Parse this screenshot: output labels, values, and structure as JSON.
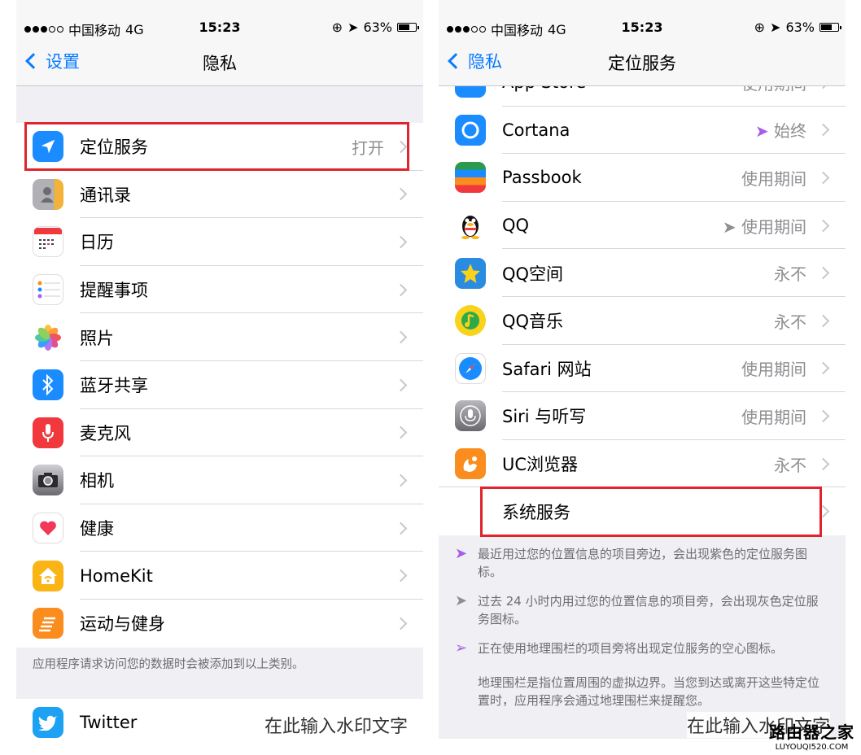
{
  "left": {
    "status": {
      "carrier": "中国移动",
      "network": "4G",
      "time": "15:23",
      "battery": "63%"
    },
    "nav": {
      "back_label": "设置",
      "title": "隐私"
    },
    "group1": [
      {
        "label": "定位服务",
        "value": "打开",
        "icon": "location-arrow-icon",
        "color": "#1a8cff"
      },
      {
        "label": "通讯录",
        "value": "",
        "icon": "contacts-icon",
        "color": "#8e8e93"
      },
      {
        "label": "日历",
        "value": "",
        "icon": "calendar-icon",
        "color": "#ffffff"
      },
      {
        "label": "提醒事项",
        "value": "",
        "icon": "reminders-icon",
        "color": "#ffffff"
      },
      {
        "label": "照片",
        "value": "",
        "icon": "photos-icon",
        "color": "#ffffff"
      },
      {
        "label": "蓝牙共享",
        "value": "",
        "icon": "bluetooth-icon",
        "color": "#1a8cff"
      },
      {
        "label": "麦克风",
        "value": "",
        "icon": "microphone-icon",
        "color": "#f0383d"
      },
      {
        "label": "相机",
        "value": "",
        "icon": "camera-icon",
        "color": "#5a5a5e"
      },
      {
        "label": "健康",
        "value": "",
        "icon": "heart-icon",
        "color": "#ffffff"
      },
      {
        "label": "HomeKit",
        "value": "",
        "icon": "homekit-icon",
        "color": "#fbb416"
      },
      {
        "label": "运动与健身",
        "value": "",
        "icon": "fitness-icon",
        "color": "#fb8c1e"
      }
    ],
    "footer": "应用程序请求访问您的数据时会被添加到以上类别。",
    "group2": [
      {
        "label": "Twitter",
        "value": "",
        "icon": "twitter-icon",
        "color": "#1da1f2"
      }
    ],
    "watermark": "在此输入水印文字"
  },
  "right": {
    "status": {
      "carrier": "中国移动",
      "network": "4G",
      "time": "15:23",
      "battery": "63%"
    },
    "nav": {
      "back_label": "隐私",
      "title": "定位服务"
    },
    "partial_row": {
      "label": "App Store",
      "value": "使用期间"
    },
    "apps": [
      {
        "label": "Cortana",
        "value": "始终",
        "arrow": true,
        "arrow_color": "#a65eea",
        "icon": "cortana-icon",
        "color": "#1a8cff"
      },
      {
        "label": "Passbook",
        "value": "使用期间",
        "arrow": false,
        "icon": "passbook-icon",
        "color": "#2c9a4b"
      },
      {
        "label": "QQ",
        "value": "使用期间",
        "arrow": true,
        "arrow_color": "#8e8e93",
        "icon": "qq-penguin-icon",
        "color": "#ffffff"
      },
      {
        "label": "QQ空间",
        "value": "永不",
        "arrow": false,
        "icon": "qzone-star-icon",
        "color": "#2a8ce0"
      },
      {
        "label": "QQ音乐",
        "value": "永不",
        "arrow": false,
        "icon": "qqmusic-icon",
        "color": "#f9d21b"
      },
      {
        "label": "Safari 网站",
        "value": "使用期间",
        "arrow": false,
        "icon": "safari-icon",
        "color": "#1a8cff"
      },
      {
        "label": "Siri 与听写",
        "value": "使用期间",
        "arrow": false,
        "icon": "siri-mic-icon",
        "color": "#8e8e93"
      },
      {
        "label": "UC浏览器",
        "value": "永不",
        "arrow": false,
        "icon": "uc-browser-icon",
        "color": "#fb8c1e"
      }
    ],
    "system_services": "系统服务",
    "notes": [
      {
        "icon": "purple-arrow-icon",
        "color": "#a65eea",
        "text": "最近用过您的位置信息的项目旁边，会出现紫色的定位服务图标。"
      },
      {
        "icon": "gray-arrow-icon",
        "color": "#8e8e93",
        "text": "过去 24 小时内用过您的位置信息的项目旁，会出现灰色定位服务图标。"
      },
      {
        "icon": "hollow-arrow-icon",
        "color": "#a65eea",
        "text": "正在使用地理围栏的项目旁将出现定位服务的空心图标。"
      }
    ],
    "geofence_note": "地理围栏是指位置周围的虚拟边界。当您到达或离开这些特定位置时，应用程序会通过地理围栏来提醒您。",
    "watermark": "在此输入水印文字",
    "logo": {
      "main": "路由器之家",
      "sub": "LUYOUQI520.COM"
    }
  }
}
